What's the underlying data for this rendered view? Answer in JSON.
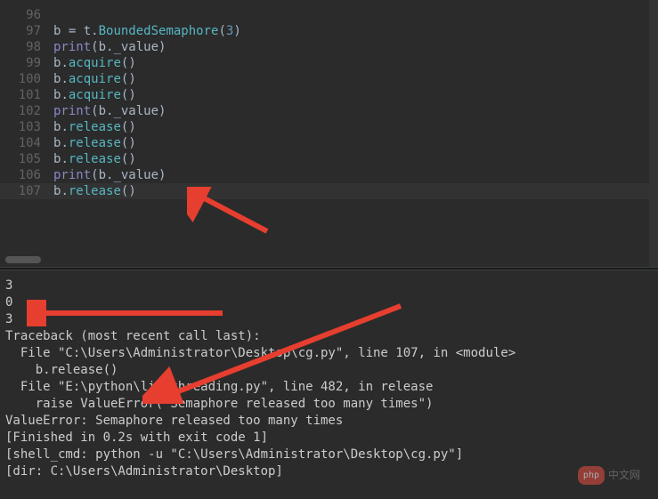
{
  "editor": {
    "lines": [
      {
        "num": "96",
        "tokens": [
          {
            "t": "",
            "c": ""
          }
        ],
        "hl": false
      },
      {
        "num": "97",
        "tokens": [
          {
            "t": "b ",
            "c": "var"
          },
          {
            "t": "=",
            "c": "op"
          },
          {
            "t": " t",
            "c": "var"
          },
          {
            "t": ".",
            "c": "op"
          },
          {
            "t": "BoundedSemaphore",
            "c": "method"
          },
          {
            "t": "(",
            "c": "paren"
          },
          {
            "t": "3",
            "c": "num"
          },
          {
            "t": ")",
            "c": "paren"
          }
        ],
        "hl": false
      },
      {
        "num": "98",
        "tokens": [
          {
            "t": "print",
            "c": "builtin"
          },
          {
            "t": "(b",
            "c": "var"
          },
          {
            "t": ".",
            "c": "op"
          },
          {
            "t": "_value",
            "c": "var"
          },
          {
            "t": ")",
            "c": "paren"
          }
        ],
        "hl": false
      },
      {
        "num": "99",
        "tokens": [
          {
            "t": "b",
            "c": "var"
          },
          {
            "t": ".",
            "c": "op"
          },
          {
            "t": "acquire",
            "c": "method"
          },
          {
            "t": "()",
            "c": "paren"
          }
        ],
        "hl": false
      },
      {
        "num": "100",
        "tokens": [
          {
            "t": "b",
            "c": "var"
          },
          {
            "t": ".",
            "c": "op"
          },
          {
            "t": "acquire",
            "c": "method"
          },
          {
            "t": "()",
            "c": "paren"
          }
        ],
        "hl": false
      },
      {
        "num": "101",
        "tokens": [
          {
            "t": "b",
            "c": "var"
          },
          {
            "t": ".",
            "c": "op"
          },
          {
            "t": "acquire",
            "c": "method"
          },
          {
            "t": "()",
            "c": "paren"
          }
        ],
        "hl": false
      },
      {
        "num": "102",
        "tokens": [
          {
            "t": "print",
            "c": "builtin"
          },
          {
            "t": "(b",
            "c": "var"
          },
          {
            "t": ".",
            "c": "op"
          },
          {
            "t": "_value",
            "c": "var"
          },
          {
            "t": ")",
            "c": "paren"
          }
        ],
        "hl": false
      },
      {
        "num": "103",
        "tokens": [
          {
            "t": "b",
            "c": "var"
          },
          {
            "t": ".",
            "c": "op"
          },
          {
            "t": "release",
            "c": "method"
          },
          {
            "t": "()",
            "c": "paren"
          }
        ],
        "hl": false
      },
      {
        "num": "104",
        "tokens": [
          {
            "t": "b",
            "c": "var"
          },
          {
            "t": ".",
            "c": "op"
          },
          {
            "t": "release",
            "c": "method"
          },
          {
            "t": "()",
            "c": "paren"
          }
        ],
        "hl": false
      },
      {
        "num": "105",
        "tokens": [
          {
            "t": "b",
            "c": "var"
          },
          {
            "t": ".",
            "c": "op"
          },
          {
            "t": "release",
            "c": "method"
          },
          {
            "t": "()",
            "c": "paren"
          }
        ],
        "hl": false
      },
      {
        "num": "106",
        "tokens": [
          {
            "t": "print",
            "c": "builtin"
          },
          {
            "t": "(b",
            "c": "var"
          },
          {
            "t": ".",
            "c": "op"
          },
          {
            "t": "_value",
            "c": "var"
          },
          {
            "t": ")",
            "c": "paren"
          }
        ],
        "hl": false
      },
      {
        "num": "107",
        "tokens": [
          {
            "t": "b",
            "c": "var"
          },
          {
            "t": ".",
            "c": "op"
          },
          {
            "t": "release",
            "c": "method"
          },
          {
            "t": "()",
            "c": "paren"
          }
        ],
        "hl": true
      }
    ]
  },
  "output": {
    "lines": [
      "3",
      "0",
      "3",
      "Traceback (most recent call last):",
      "  File \"C:\\Users\\Administrator\\Desktop\\cg.py\", line 107, in <module>",
      "    b.release()",
      "  File \"E:\\python\\lib\\threading.py\", line 482, in release",
      "    raise ValueError(\"Semaphore released too many times\")",
      "ValueError: Semaphore released too many times",
      "[Finished in 0.2s with exit code 1]",
      "[shell_cmd: python -u \"C:\\Users\\Administrator\\Desktop\\cg.py\"]",
      "[dir: C:\\Users\\Administrator\\Desktop]"
    ]
  },
  "watermark": {
    "badge": "php",
    "text": "中文网"
  },
  "arrows": {
    "color": "#e63e2f"
  }
}
